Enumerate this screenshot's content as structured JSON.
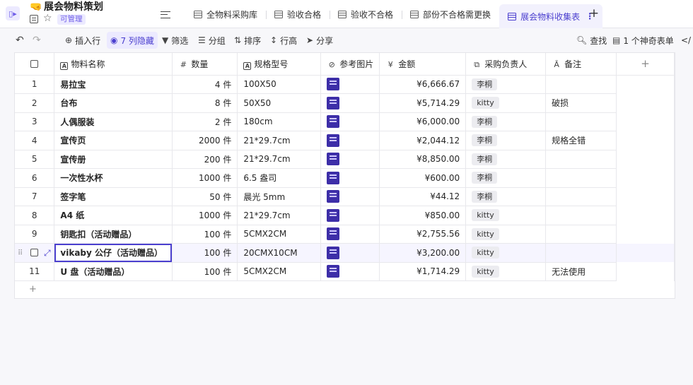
{
  "header": {
    "title_emoji": "🤜",
    "title": "展会物料策划",
    "permission_badge": "可管理"
  },
  "tabs": [
    {
      "label": "全物料采购库",
      "active": false
    },
    {
      "label": "验收合格",
      "active": false
    },
    {
      "label": "验收不合格",
      "active": false
    },
    {
      "label": "部份不合格需更换",
      "active": false
    },
    {
      "label": "展会物料收集表",
      "active": true
    }
  ],
  "toolbar": {
    "insert_row": "插入行",
    "hidden_columns": "7 列隐藏",
    "filter": "筛选",
    "group": "分组",
    "sort": "排序",
    "row_height": "行高",
    "share": "分享",
    "find": "查找",
    "form": "1 个神奇表单",
    "api_label": "</"
  },
  "columns": {
    "name": "物料名称",
    "qty": "数量",
    "spec": "规格型号",
    "image": "参考图片",
    "amount": "金额",
    "owner": "采购负责人",
    "note": "备注"
  },
  "rows": [
    {
      "no": "1",
      "name": "易拉宝",
      "qty": "4 件",
      "spec": "100X50",
      "amount": "¥6,666.67",
      "owner": "李桐",
      "note": ""
    },
    {
      "no": "2",
      "name": "台布",
      "qty": "8 件",
      "spec": "50X50",
      "amount": "¥5,714.29",
      "owner": "kitty",
      "note": "破损"
    },
    {
      "no": "3",
      "name": "人偶服装",
      "qty": "2 件",
      "spec": "180cm",
      "amount": "¥6,000.00",
      "owner": "李桐",
      "note": ""
    },
    {
      "no": "4",
      "name": "宣传页",
      "qty": "2000 件",
      "spec": "21*29.7cm",
      "amount": "¥2,044.12",
      "owner": "李桐",
      "note": "规格全错"
    },
    {
      "no": "5",
      "name": "宣传册",
      "qty": "200 件",
      "spec": "21*29.7cm",
      "amount": "¥8,850.00",
      "owner": "李桐",
      "note": ""
    },
    {
      "no": "6",
      "name": "一次性水杯",
      "qty": "1000 件",
      "spec": "6.5 盎司",
      "amount": "¥600.00",
      "owner": "李桐",
      "note": ""
    },
    {
      "no": "7",
      "name": "签字笔",
      "qty": "50 件",
      "spec": "晨光 5mm",
      "amount": "¥44.12",
      "owner": "李桐",
      "note": ""
    },
    {
      "no": "8",
      "name": "A4 纸",
      "qty": "1000 件",
      "spec": "21*29.7cm",
      "amount": "¥850.00",
      "owner": "kitty",
      "note": ""
    },
    {
      "no": "9",
      "name": "钥匙扣（活动赠品）",
      "qty": "100 件",
      "spec": "5CMX2CM",
      "amount": "¥2,755.56",
      "owner": "kitty",
      "note": ""
    },
    {
      "no": "",
      "name": "vikaby 公仔（活动赠品）",
      "qty": "100 件",
      "spec": "20CMX10CM",
      "amount": "¥3,200.00",
      "owner": "kitty",
      "note": ""
    },
    {
      "no": "11",
      "name": "U 盘（活动赠品）",
      "qty": "100 件",
      "spec": "5CMX2CM",
      "amount": "¥1,714.29",
      "owner": "kitty",
      "note": "无法使用"
    }
  ],
  "add_row_label": "+",
  "add_column_label": "+"
}
